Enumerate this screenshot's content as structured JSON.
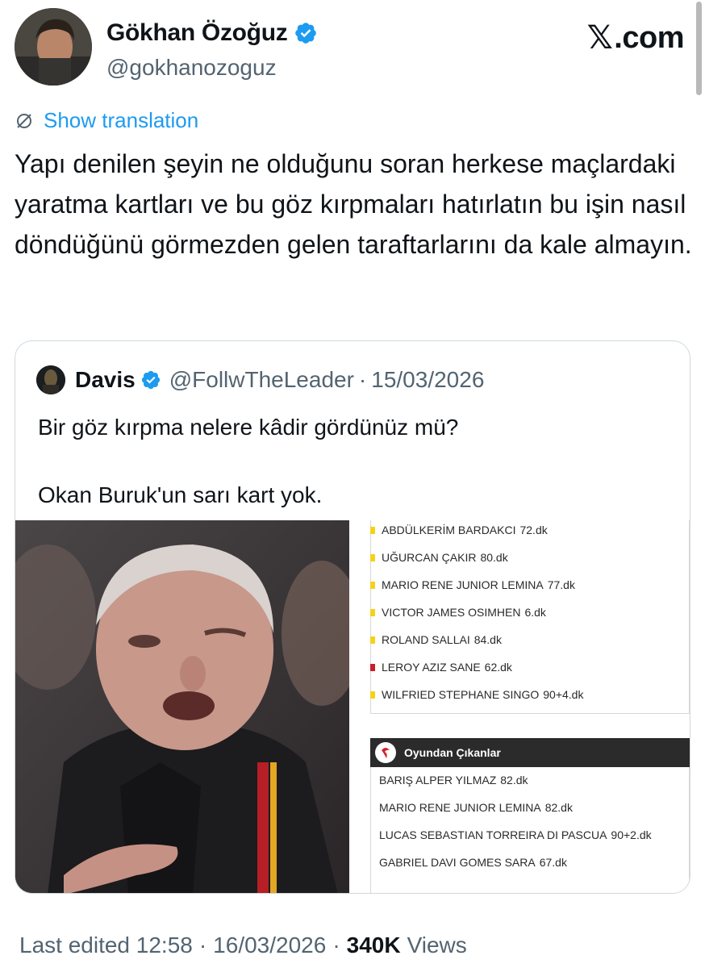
{
  "header": {
    "author_name": "Gökhan Özoğuz",
    "author_handle": "@gokhanozoguz",
    "brand": ".com",
    "brand_mark": "𝕏"
  },
  "translate_label": "Show translation",
  "tweet_text": "Yapı denilen şeyin ne olduğunu soran herkese maçlardaki yaratma kartları ve bu göz kırpmaları hatırlatın bu işin nasıl döndüğünü görmezden gelen taraftarlarını da kale almayın.",
  "quote": {
    "name": "Davis",
    "handle": "@FollwTheLeader",
    "dot": "·",
    "date": "15/03/2026",
    "line1": "Bir göz kırpma nelere kâdir gördünüz mü?",
    "line2": "Okan Buruk'un sarı kart yok.",
    "cards": [
      {
        "player": "ABDÜLKERİM BARDAKCI",
        "minute": "72.dk",
        "color": "yellow"
      },
      {
        "player": "UĞURCAN ÇAKIR",
        "minute": "80.dk",
        "color": "yellow"
      },
      {
        "player": "MARIO RENE JUNIOR LEMINA",
        "minute": "77.dk",
        "color": "yellow"
      },
      {
        "player": "VICTOR JAMES OSIMHEN",
        "minute": "6.dk",
        "color": "yellow"
      },
      {
        "player": "ROLAND SALLAI",
        "minute": "84.dk",
        "color": "yellow"
      },
      {
        "player": "LEROY AZIZ SANE",
        "minute": "62.dk",
        "color": "red"
      },
      {
        "player": "WILFRIED STEPHANE SINGO",
        "minute": "90+4.dk",
        "color": "yellow"
      }
    ],
    "subs_title": "Oyundan Çıkanlar",
    "subs": [
      {
        "player": "BARIŞ ALPER YILMAZ",
        "minute": "82.dk"
      },
      {
        "player": "MARIO RENE JUNIOR LEMINA",
        "minute": "82.dk"
      },
      {
        "player": "LUCAS SEBASTIAN TORREIRA DI PASCUA",
        "minute": "90+2.dk"
      },
      {
        "player": "GABRIEL DAVI GOMES SARA",
        "minute": "67.dk"
      }
    ]
  },
  "footer": {
    "edited": "Last edited 12:58",
    "dot": "·",
    "date": "16/03/2026",
    "views_count": "340K",
    "views_label": "Views"
  },
  "colors": {
    "link": "#1d9bf0",
    "muted": "#536471",
    "text": "#0f1419",
    "yellow_card": "#f4d21a",
    "red_card": "#c81e2a"
  }
}
